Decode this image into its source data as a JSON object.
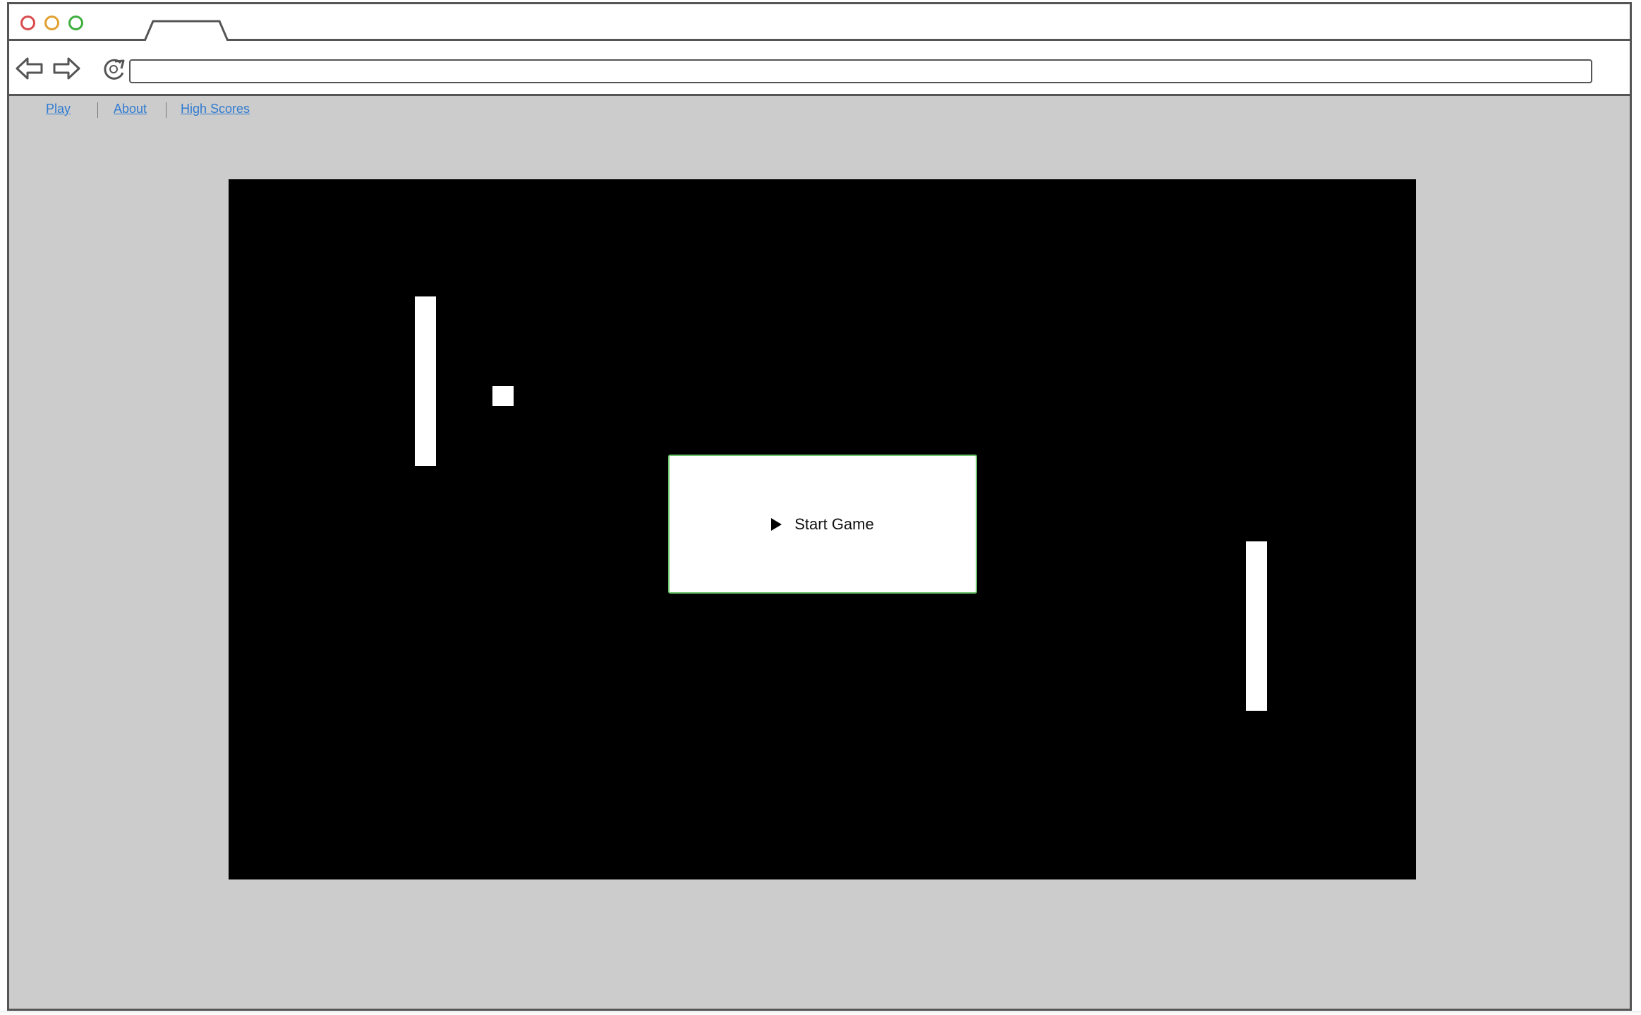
{
  "browser": {
    "traffic_lights": [
      {
        "name": "close",
        "color": "#d94c4c"
      },
      {
        "name": "minimize",
        "color": "#e0a030"
      },
      {
        "name": "maximize",
        "color": "#3fae3f"
      }
    ],
    "icons": {
      "back": "back-arrow-icon",
      "forward": "forward-arrow-icon",
      "reload": "reload-icon"
    },
    "address_value": ""
  },
  "nav_links": [
    {
      "label": "Play"
    },
    {
      "label": "About"
    },
    {
      "label": "High Scores"
    }
  ],
  "game": {
    "start_label": "Start Game",
    "start_icon": "play-icon",
    "colors": {
      "canvas": "#000000",
      "pieces": "#ffffff",
      "button_border": "#6cc46c"
    }
  }
}
